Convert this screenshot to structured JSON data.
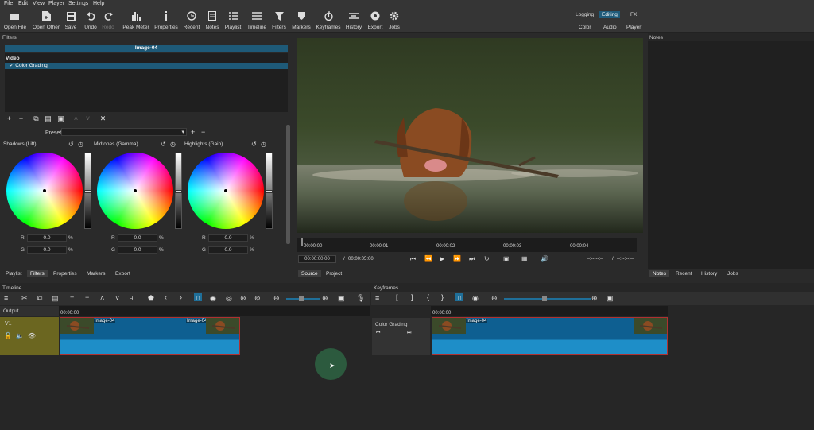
{
  "menu": [
    "File",
    "Edit",
    "View",
    "Player",
    "Settings",
    "Help"
  ],
  "toolbar": [
    {
      "label": "Open File",
      "icon": "folder-open-icon"
    },
    {
      "label": "Open Other",
      "icon": "file-plus-icon"
    },
    {
      "label": "Save",
      "icon": "save-icon"
    },
    {
      "label": "Undo",
      "icon": "undo-icon"
    },
    {
      "label": "Redo",
      "icon": "redo-icon"
    },
    {
      "label": "Peak Meter",
      "icon": "peak-meter-icon"
    },
    {
      "label": "Properties",
      "icon": "info-icon"
    },
    {
      "label": "Recent",
      "icon": "clock-icon"
    },
    {
      "label": "Notes",
      "icon": "notes-icon"
    },
    {
      "label": "Playlist",
      "icon": "list-icon"
    },
    {
      "label": "Timeline",
      "icon": "timeline-icon"
    },
    {
      "label": "Filters",
      "icon": "filter-icon"
    },
    {
      "label": "Markers",
      "icon": "marker-icon"
    },
    {
      "label": "Keyframes",
      "icon": "stopwatch-icon"
    },
    {
      "label": "History",
      "icon": "history-icon"
    },
    {
      "label": "Export",
      "icon": "export-icon"
    },
    {
      "label": "Jobs",
      "icon": "gear-icon"
    }
  ],
  "modes": {
    "logging": "Logging",
    "editing": "Editing",
    "fx": "FX",
    "color": "Color",
    "audio": "Audio",
    "player": "Player"
  },
  "filters": {
    "title": "Filters",
    "clip_name": "Image-04",
    "section": "Video",
    "item": "Color Grading",
    "check": "✓",
    "preset_label": "Preset",
    "wheels": [
      {
        "label": "Shadows (Lift)",
        "r": "0.0",
        "g": "0.0"
      },
      {
        "label": "Midtones (Gamma)",
        "r": "0.0",
        "g": "0.0"
      },
      {
        "label": "Highlights (Gain)",
        "r": "0.0",
        "g": "0.0"
      }
    ],
    "r_label": "R",
    "g_label": "G",
    "pct": "%"
  },
  "left_tabs": [
    "Playlist",
    "Filters",
    "Properties",
    "Markers",
    "Export"
  ],
  "player": {
    "ticks": [
      "00:00:00",
      "00:00:01",
      "00:00:02",
      "00:00:03",
      "00:00:04"
    ],
    "timecode": "00:00:00:00",
    "separator": "/",
    "duration": "00:00:05:00",
    "in_out": "--:--:--:--",
    "in_out2": "--:--:--:--",
    "tabs": [
      "Source",
      "Project"
    ]
  },
  "notes": {
    "title": "Notes",
    "tabs": [
      "Notes",
      "Recent",
      "History",
      "Jobs"
    ]
  },
  "timeline": {
    "title": "Timeline",
    "output": "Output",
    "track": "V1",
    "tc": "00:00:00",
    "clip_label": "Image-04",
    "clip_label2": "Image-04"
  },
  "keyframes": {
    "title": "Keyframes",
    "filter": "Color Grading",
    "tc": "00:00:00",
    "clip_label": "Image-04"
  }
}
